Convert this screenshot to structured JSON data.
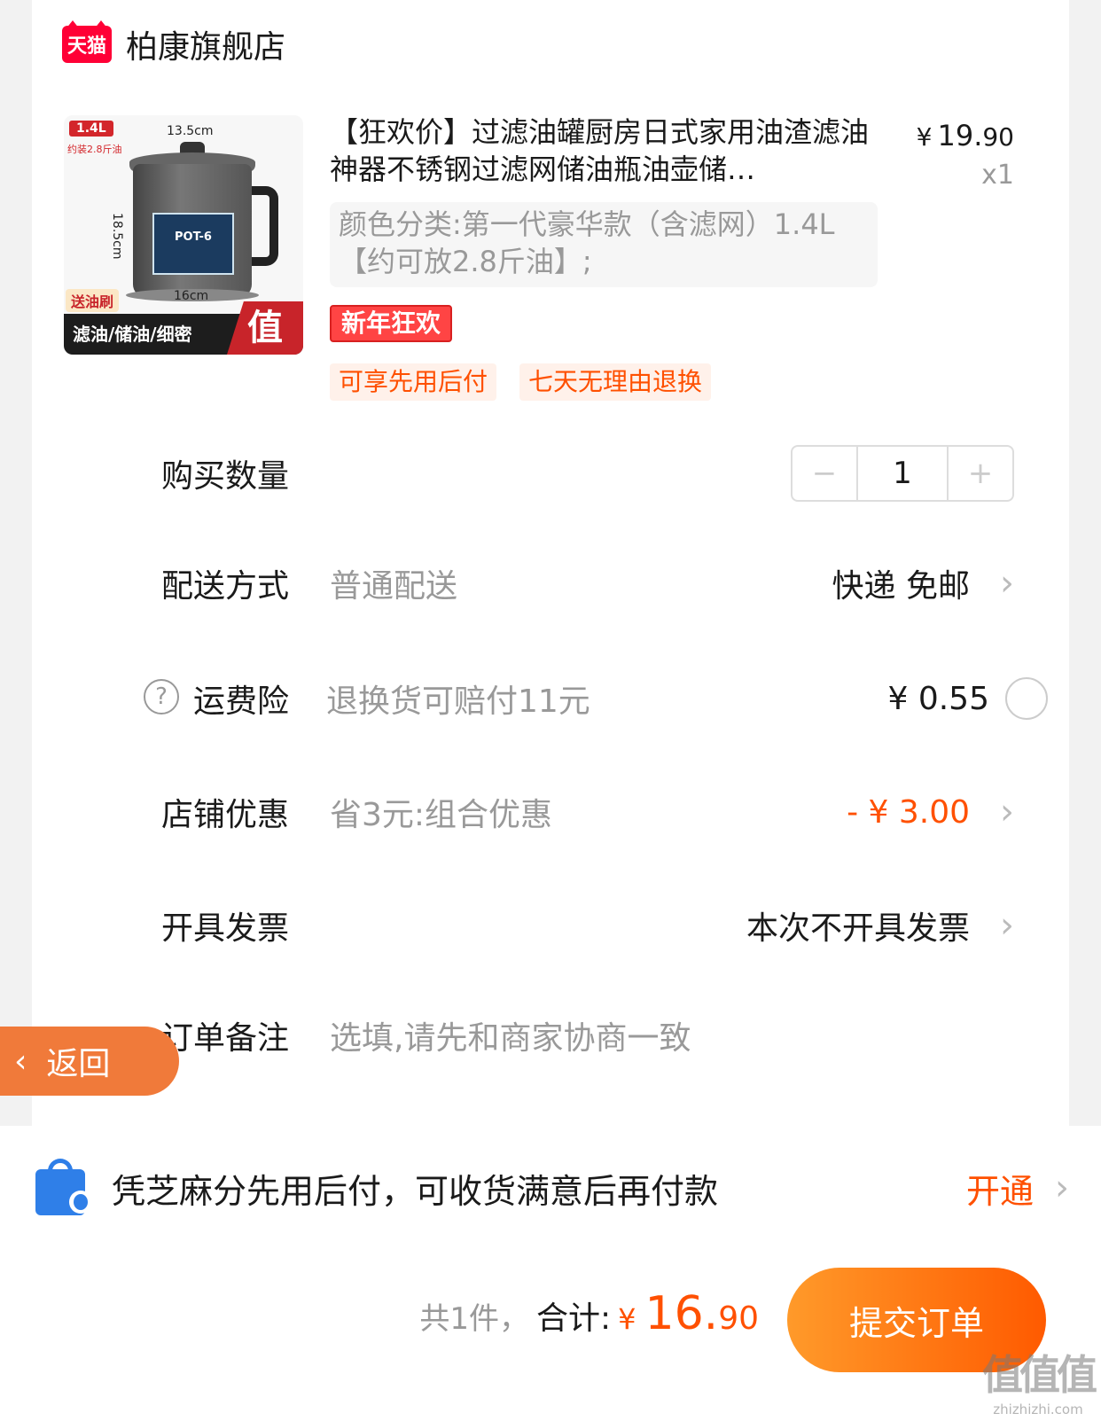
{
  "shop": {
    "logo_text": "天猫",
    "name": "柏康旗舰店"
  },
  "product": {
    "image": {
      "capacity_badge": "1.4L",
      "capacity_note": "约装2.8斤油",
      "width_top": "13.5cm",
      "height": "18.5cm",
      "width_bottom": "16cm",
      "label_text": "POT-6",
      "gift": "送油刷",
      "features": "滤油/储油/细密",
      "value_badge": "值"
    },
    "title": "【狂欢价】过滤油罐厨房日式家用油渣滤油神器不锈钢过滤网储油瓶油壶储…",
    "price_symbol": "¥",
    "price_int": "19.",
    "price_dec": "90",
    "quantity_mark": "x1",
    "sku": "颜色分类:第一代豪华款（含滤网）1.4L【约可放2.8斤油】;",
    "promo_tag": "新年狂欢",
    "services": [
      "可享先用后付",
      "七天无理由退换"
    ]
  },
  "rows": {
    "quantity": {
      "label": "购买数量",
      "minus": "−",
      "value": "1",
      "plus": "+"
    },
    "delivery": {
      "label": "配送方式",
      "desc": "普通配送",
      "value": "快递 免邮"
    },
    "insurance": {
      "help": "?",
      "label": "运费险",
      "desc": "退换货可赔付11元",
      "value": "¥ 0.55"
    },
    "discount": {
      "label": "店铺优惠",
      "desc": "省3元:组合优惠",
      "value": "- ¥ 3.00"
    },
    "invoice": {
      "label": "开具发票",
      "value": "本次不开具发票"
    },
    "remark": {
      "label": "订单备注",
      "placeholder": "选填,请先和商家协商一致"
    }
  },
  "back_button": {
    "label": "返回"
  },
  "pay_later": {
    "text": "凭芝麻分先用后付，可收货满意后再付款",
    "action": "开通"
  },
  "footer": {
    "count": "共1件，",
    "total_label": "合计:",
    "currency": "¥",
    "total_int": "16.",
    "total_dec": "90",
    "submit": "提交订单"
  },
  "watermark": {
    "line1": "值值值",
    "line2": "zhizhizhi.com"
  },
  "colors": {
    "accent": "#ff5000",
    "tmall_red": "#ff0036",
    "back_orange": "#f07a3a",
    "pay_blue": "#2f7fe8"
  }
}
